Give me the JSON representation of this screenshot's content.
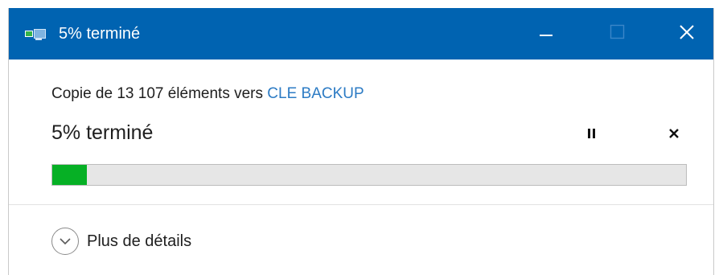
{
  "window": {
    "title": "5% terminé",
    "accent_color": "#0063b1"
  },
  "titlebar_buttons": {
    "minimize_icon": "minimize-icon",
    "maximize_icon": "maximize-icon",
    "close_icon": "close-icon"
  },
  "copy": {
    "prefix": "Copie de 13 107 éléments",
    "connector": "vers",
    "destination": "CLE BACKUP",
    "destination_color": "#2c7bc4"
  },
  "status": {
    "text": "5% terminé",
    "percent": 5
  },
  "controls": {
    "pause_icon": "pause-icon",
    "cancel_icon": "cancel-icon"
  },
  "progress": {
    "value": 0.055,
    "fill_color": "#06b025"
  },
  "details": {
    "label": "Plus de détails",
    "icon": "chevron-down-circle-icon"
  }
}
